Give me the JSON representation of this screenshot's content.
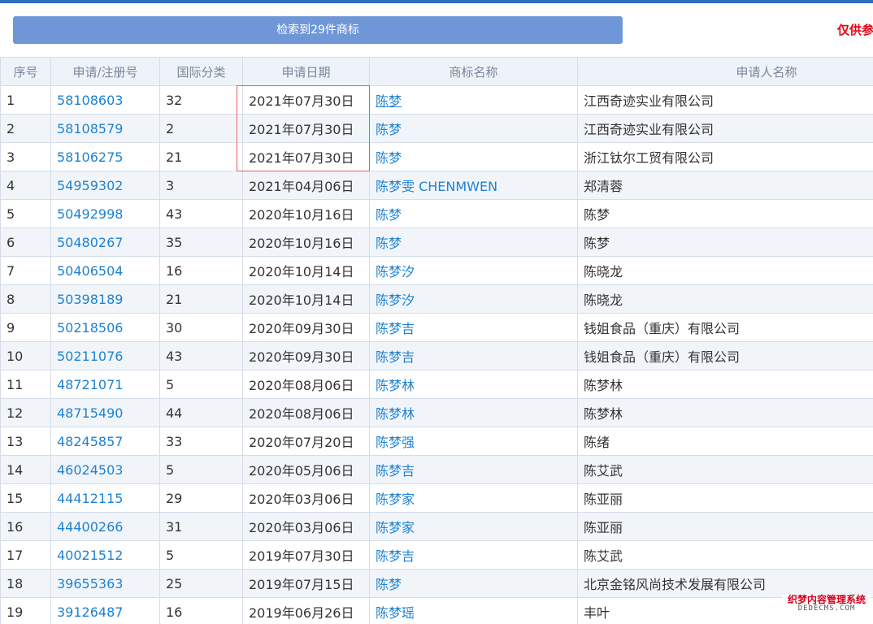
{
  "search_button_label": "检索到29件商标",
  "notice": "仅供参",
  "columns": [
    "序号",
    "申请/注册号",
    "国际分类",
    "申请日期",
    "商标名称",
    "申请人名称"
  ],
  "rows": [
    [
      "1",
      "58108603",
      "32",
      "2021年07月30日",
      "陈梦",
      "江西奇迹实业有限公司"
    ],
    [
      "2",
      "58108579",
      "2",
      "2021年07月30日",
      "陈梦",
      "江西奇迹实业有限公司"
    ],
    [
      "3",
      "58106275",
      "21",
      "2021年07月30日",
      "陈梦",
      "浙江钛尔工贸有限公司"
    ],
    [
      "4",
      "54959302",
      "3",
      "2021年04月06日",
      "陈梦雯 CHENMWEN",
      "郑清蓉"
    ],
    [
      "5",
      "50492998",
      "43",
      "2020年10月16日",
      "陈梦",
      "陈梦"
    ],
    [
      "6",
      "50480267",
      "35",
      "2020年10月16日",
      "陈梦",
      "陈梦"
    ],
    [
      "7",
      "50406504",
      "16",
      "2020年10月14日",
      "陈梦汐",
      "陈晓龙"
    ],
    [
      "8",
      "50398189",
      "21",
      "2020年10月14日",
      "陈梦汐",
      "陈晓龙"
    ],
    [
      "9",
      "50218506",
      "30",
      "2020年09月30日",
      "陈梦吉",
      "钱姐食品（重庆）有限公司"
    ],
    [
      "10",
      "50211076",
      "43",
      "2020年09月30日",
      "陈梦吉",
      "钱姐食品（重庆）有限公司"
    ],
    [
      "11",
      "48721071",
      "5",
      "2020年08月06日",
      "陈梦林",
      "陈梦林"
    ],
    [
      "12",
      "48715490",
      "44",
      "2020年08月06日",
      "陈梦林",
      "陈梦林"
    ],
    [
      "13",
      "48245857",
      "33",
      "2020年07月20日",
      "陈梦强",
      "陈绪"
    ],
    [
      "14",
      "46024503",
      "5",
      "2020年05月06日",
      "陈梦吉",
      "陈艾武"
    ],
    [
      "15",
      "44412115",
      "29",
      "2020年03月06日",
      "陈梦家",
      "陈亚丽"
    ],
    [
      "16",
      "44400266",
      "31",
      "2020年03月06日",
      "陈梦家",
      "陈亚丽"
    ],
    [
      "17",
      "40021512",
      "5",
      "2019年07月30日",
      "陈梦吉",
      "陈艾武"
    ],
    [
      "18",
      "39655363",
      "25",
      "2019年07月15日",
      "陈梦",
      "北京金铭风尚技术发展有限公司"
    ],
    [
      "19",
      "39126487",
      "16",
      "2019年06月26日",
      "陈梦瑶",
      "丰叶"
    ]
  ],
  "watermark": {
    "cn": "织梦内容管理系统",
    "en": "DEDECMS.COM"
  },
  "colors": {
    "link": "#1e82d2",
    "button": "#6f97d8",
    "notice": "#e60012",
    "highlight_box": "#e85c5c"
  }
}
